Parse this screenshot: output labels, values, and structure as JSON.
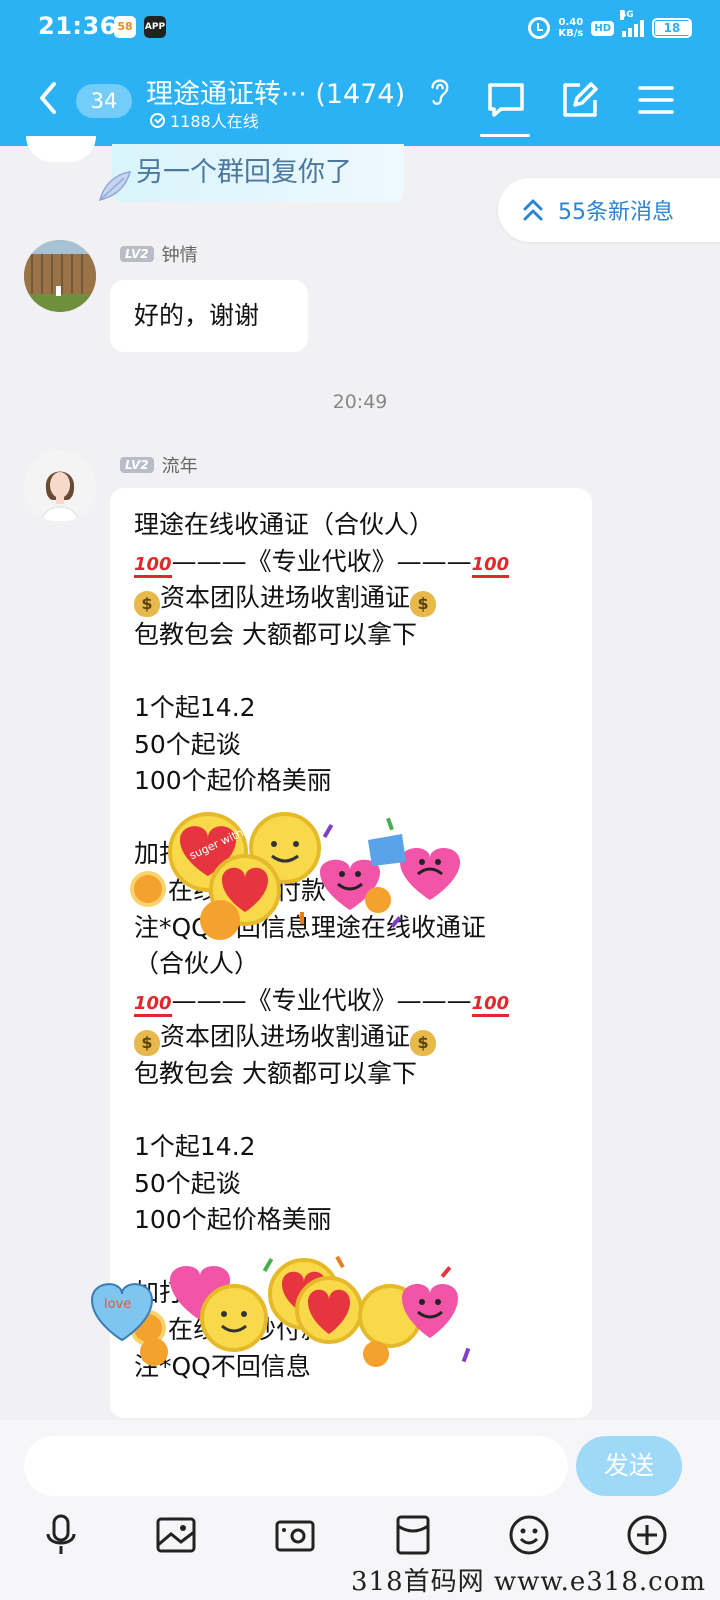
{
  "status_bar": {
    "time": "21:36",
    "app_icon_1": "58",
    "app_icon_2": "APP",
    "net_speed_value": "0.40",
    "net_speed_unit": "KB/s",
    "hd_label": "HD",
    "network_label": "4G",
    "battery": "18"
  },
  "header": {
    "unread_count": "34",
    "title": "理途通证转··· (1474)",
    "online": "1188人在线",
    "colors": {
      "bar": "#2ab2f5",
      "text": "#ffffff"
    },
    "icons": [
      "back-icon",
      "ear-icon",
      "chat-icon",
      "edit-icon",
      "menu-icon"
    ]
  },
  "previous_message": {
    "text": "另一个群回复你了"
  },
  "new_messages_pill": {
    "label": "55条新消息"
  },
  "messages": [
    {
      "level": "LV2",
      "sender": "钟情",
      "text": "好的，谢谢"
    }
  ],
  "timestamp": "20:49",
  "big_message": {
    "level": "LV2",
    "sender": "流年",
    "lines": [
      "理途在线收通证（合伙人）",
      "———《专业代收》———",
      "资本团队进场收割通证",
      "包教包会 大额都可以拿下",
      "",
      "1个起14.2",
      "50个起谈",
      "100个起价格美丽",
      "",
      "加打款）",
      "在线收 秒付款",
      "注*QQ不回信息理途在线收通证",
      "（合伙人）",
      "———《专业代收》———",
      "资本团队进场收割通证",
      "包教包会 大额都可以拿下",
      "",
      "1个起14.2",
      "50个起谈",
      "100个起价格美丽",
      "",
      "加打款）",
      "在线收 秒付款",
      "注*QQ不回信息"
    ],
    "emoji_100": "100",
    "money_symbol": "$"
  },
  "stickers": {
    "text_1": "suger with love",
    "text_2": "love"
  },
  "input": {
    "placeholder": "",
    "send_label": "发送"
  },
  "toolbar_icons": [
    "microphone-icon",
    "image-icon",
    "camera-icon",
    "red-packet-icon",
    "emoji-icon",
    "plus-icon"
  ],
  "watermark": "318首码网 www.e318.com"
}
